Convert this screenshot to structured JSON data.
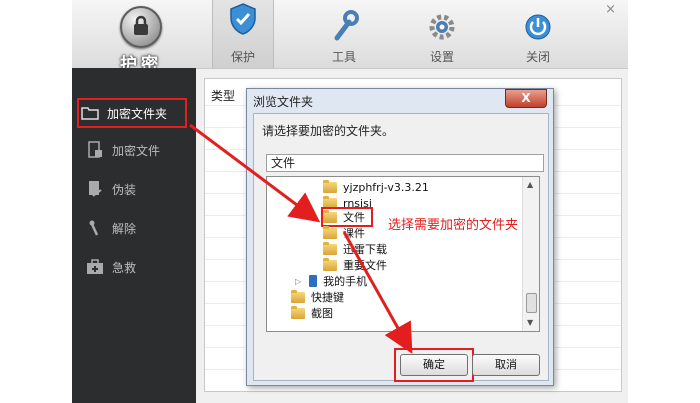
{
  "app": {
    "logo_label": "护密",
    "close_glyph": "×",
    "tabs": [
      {
        "label": "保护",
        "icon": "shield-icon",
        "active": true
      },
      {
        "label": "工具",
        "icon": "wrench-icon",
        "active": false
      },
      {
        "label": "设置",
        "icon": "gear-icon",
        "active": false
      },
      {
        "label": "关闭",
        "icon": "power-icon",
        "active": false
      }
    ]
  },
  "sidebar": {
    "items": [
      {
        "label": "加密文件夹",
        "icon": "folder-icon",
        "active": true
      },
      {
        "label": "加密文件",
        "icon": "file-lock-icon",
        "active": false
      },
      {
        "label": "伪装",
        "icon": "disguise-icon",
        "active": false
      },
      {
        "label": "解除",
        "icon": "unlock-icon",
        "active": false
      },
      {
        "label": "急救",
        "icon": "first-aid-icon",
        "active": false
      }
    ]
  },
  "content": {
    "type_header": "类型"
  },
  "dialog": {
    "title": "浏览文件夹",
    "close_glyph": "X",
    "prompt": "请选择要加密的文件夹。",
    "current_path": "文件",
    "tree": [
      {
        "label": "yjzphfrj-v3.3.21"
      },
      {
        "label": "rnsjsj"
      },
      {
        "label": "文件",
        "selected": true
      },
      {
        "label": "课件"
      },
      {
        "label": "迅雷下载"
      },
      {
        "label": "重要文件"
      },
      {
        "label": "我的手机"
      },
      {
        "label": "快捷键"
      },
      {
        "label": "截图"
      }
    ],
    "ok_label": "确定",
    "cancel_label": "取消"
  },
  "annotation": {
    "text": "选择需要加密的文件夹",
    "color": "#e21e1e"
  }
}
